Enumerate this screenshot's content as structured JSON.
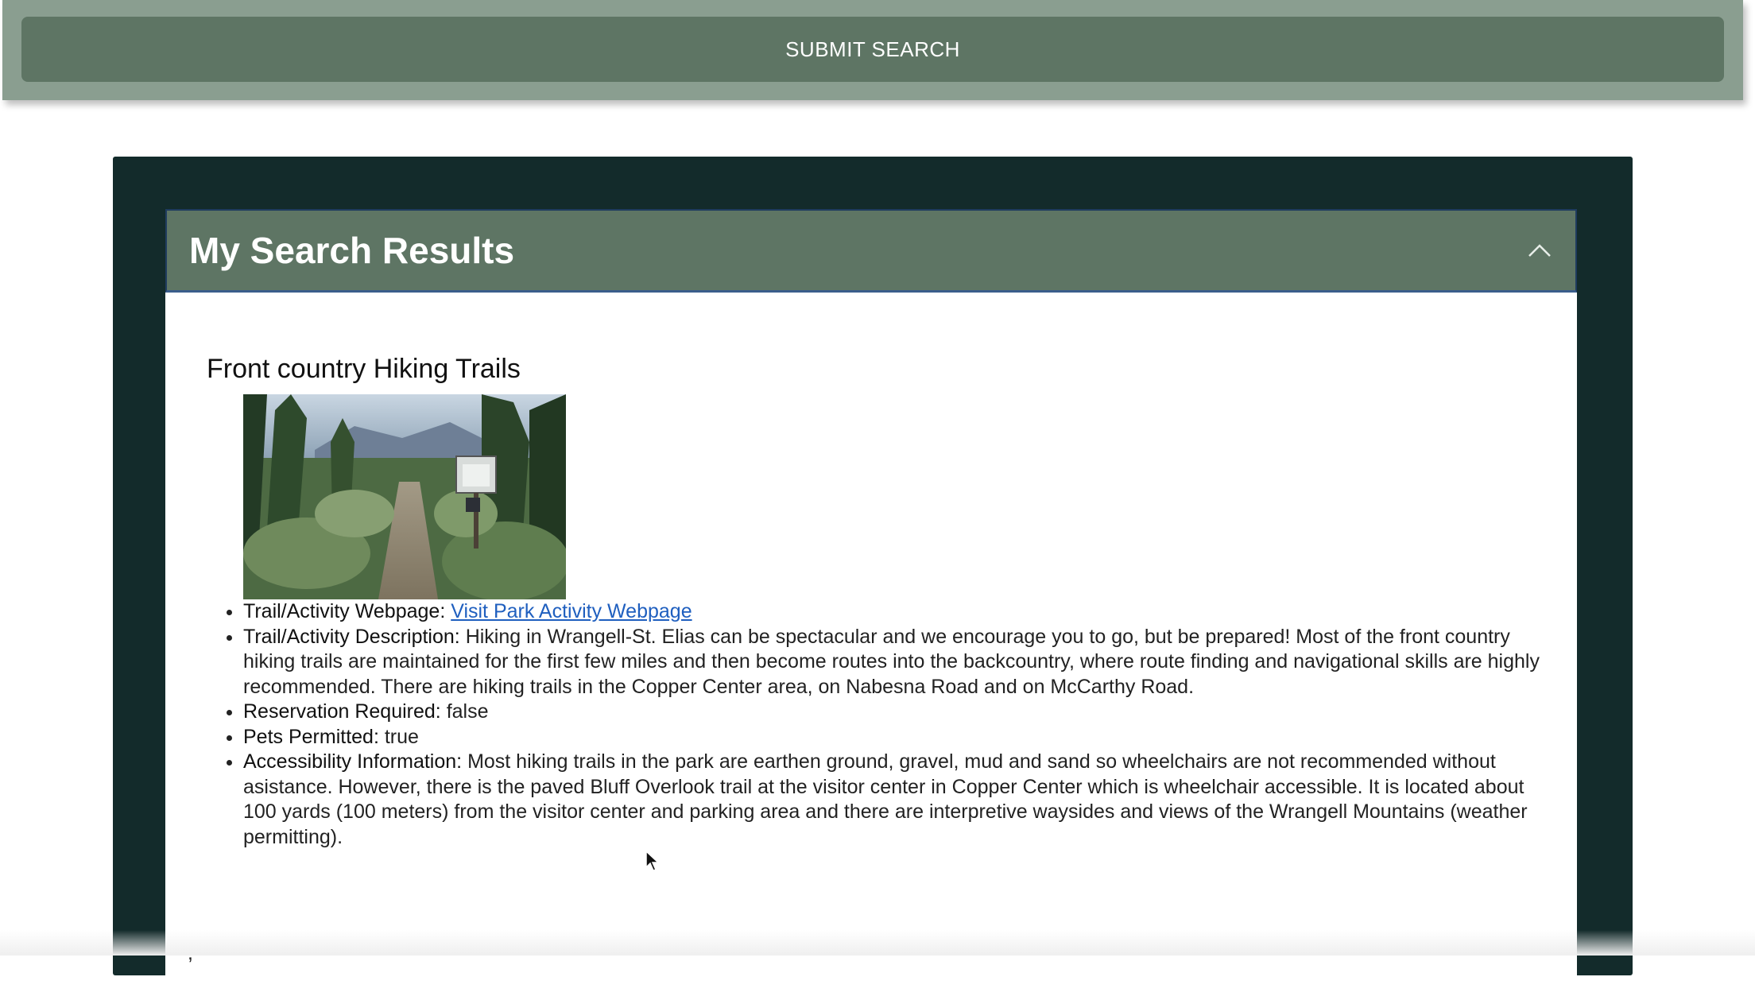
{
  "search": {
    "submit_label": "SUBMIT SEARCH"
  },
  "results": {
    "title": "My Search Results",
    "toggle_icon": "chevron-up-icon",
    "item": {
      "name": "Front country Hiking Trails",
      "image_alt": "Trailhead with information sign among spruce trees",
      "webpage_label": "Trail/Activity Webpage:",
      "webpage_link_text": "Visit Park Activity Webpage",
      "description_label": "Trail/Activity Description:",
      "description": "Hiking in Wrangell-St. Elias can be spectacular and we encourage you to go, but be prepared! Most of the front country hiking trails are maintained for the first few miles and then become routes into the backcountry, where route finding and navigational skills are highly recommended. There are hiking trails in the Copper Center area, on Nabesna Road and on McCarthy Road.",
      "reservation_label": "Reservation Required:",
      "reservation_value": "false",
      "pets_label": "Pets Permitted:",
      "pets_value": "true",
      "accessibility_label": "Accessibility Information:",
      "accessibility": "Most hiking trails in the park are earthen ground, gravel, mud and sand so wheelchairs are not recommended without asistance. However, there is the paved Bluff Overlook trail at the visitor center in Copper Center which is wheelchair accessible. It is located about 100 yards (100 meters) from the visitor center and parking area and there are interpretive waysides and views of the Wrangell Mountains (weather permitting)."
    },
    "separator": ","
  },
  "colors": {
    "top_bar": "#8a9e90",
    "button": "#5e7564",
    "outer_panel": "#132b2b",
    "header": "#5e7564",
    "link": "#1f5fbf"
  }
}
